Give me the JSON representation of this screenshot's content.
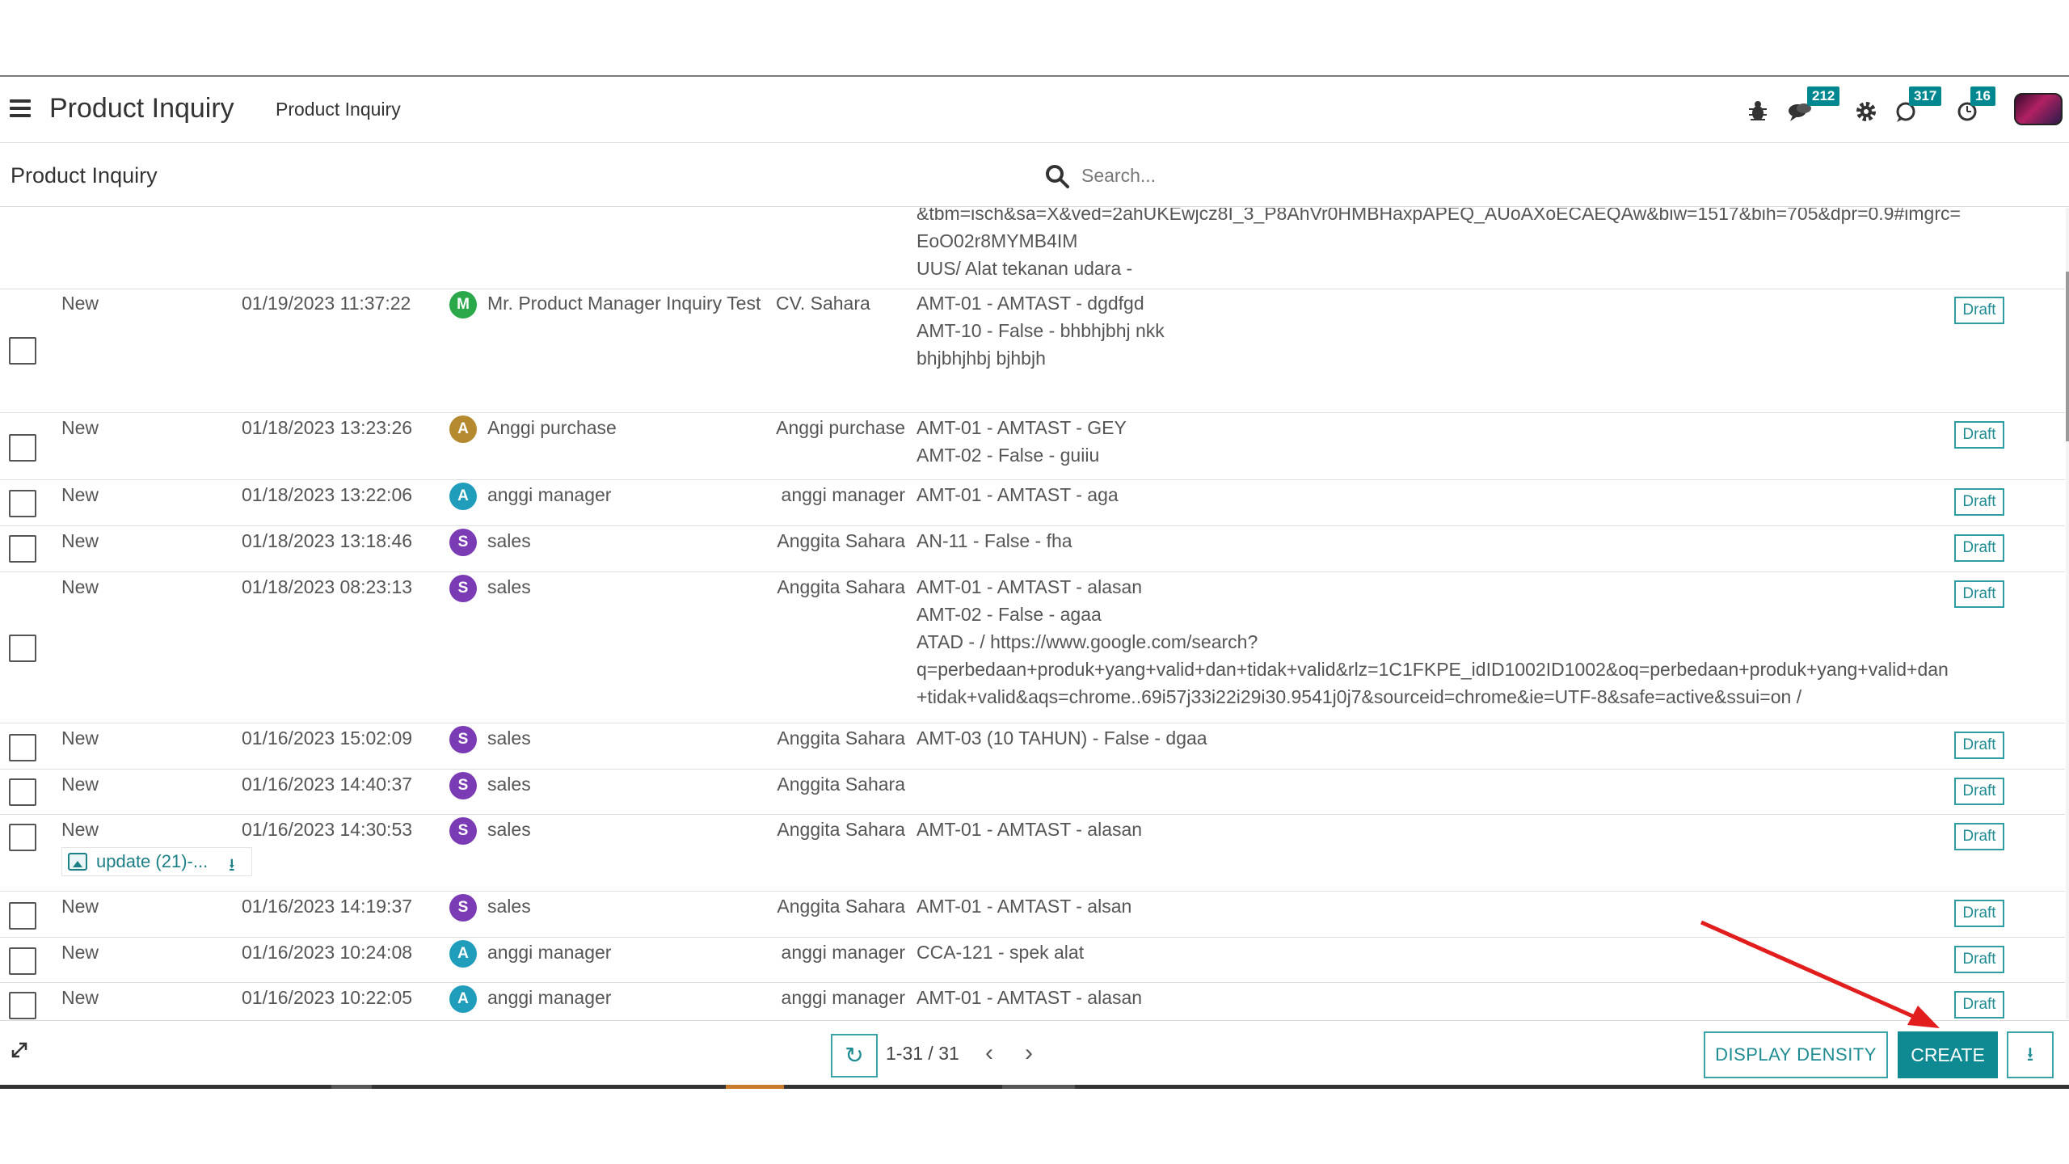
{
  "header": {
    "app_title": "Product Inquiry",
    "breadcrumb": "Product Inquiry",
    "chat_count": "212",
    "activity_count": "317",
    "clock_count": "16"
  },
  "control_panel": {
    "title": "Product Inquiry",
    "search_placeholder": "Search..."
  },
  "partial_row": {
    "lines": [
      "&tbm=isch&sa=X&ved=2ahUKEwjcz8I_3_P8AhVr0HMBHaxpAPEQ_AUoAXoECAEQAw&biw=1517&bih=705&dpr=0.9#imgrc=",
      "EoO02r8MYMB4IM",
      "UUS/ Alat tekanan udara -"
    ]
  },
  "rows": [
    {
      "status": "New",
      "date": "01/19/2023 11:37:22",
      "avatar_letter": "M",
      "avatar_color": "#2aa84a",
      "user": "Mr. Product Manager Inquiry Test",
      "company": "CV. Sahara",
      "details": [
        "AMT-01 - AMTAST - dgdfgd",
        "AMT-10 - False - bhbhjbhj nkk",
        "bhjbhjhbj bjhbjh"
      ],
      "state": "Draft"
    },
    {
      "status": "New",
      "date": "01/18/2023 13:23:26",
      "avatar_letter": "A",
      "avatar_color": "#b58a2e",
      "user": "Anggi purchase",
      "company": "Anggi purchase",
      "details": [
        "AMT-01 - AMTAST - GEY",
        "AMT-02 - False - guiiu"
      ],
      "state": "Draft"
    },
    {
      "status": "New",
      "date": "01/18/2023 13:22:06",
      "avatar_letter": "A",
      "avatar_color": "#1f9dbb",
      "user": "anggi manager",
      "company": "anggi manager",
      "details": [
        "AMT-01 - AMTAST - aga"
      ],
      "state": "Draft"
    },
    {
      "status": "New",
      "date": "01/18/2023 13:18:46",
      "avatar_letter": "S",
      "avatar_color": "#7a3bb5",
      "user": "sales",
      "company": "Anggita Sahara",
      "details": [
        "AN-11 - False - fha"
      ],
      "state": "Draft"
    },
    {
      "status": "New",
      "date": "01/18/2023 08:23:13",
      "avatar_letter": "S",
      "avatar_color": "#7a3bb5",
      "user": "sales",
      "company": "Anggita Sahara",
      "details": [
        "AMT-01 - AMTAST - alasan",
        "AMT-02 - False - agaa",
        "ATAD - / https://www.google.com/search?",
        "q=perbedaan+produk+yang+valid+dan+tidak+valid&rlz=1C1FKPE_idID1002ID1002&oq=perbedaan+produk+yang+valid+dan",
        "+tidak+valid&aqs=chrome..69i57j33i22i29i30.9541j0j7&sourceid=chrome&ie=UTF-8&safe=active&ssui=on /"
      ],
      "state": "Draft"
    },
    {
      "status": "New",
      "date": "01/16/2023 15:02:09",
      "avatar_letter": "S",
      "avatar_color": "#7a3bb5",
      "user": "sales",
      "company": "Anggita Sahara",
      "details": [
        "AMT-03 (10 TAHUN) - False - dgaa"
      ],
      "state": "Draft"
    },
    {
      "status": "New",
      "date": "01/16/2023 14:40:37",
      "avatar_letter": "S",
      "avatar_color": "#7a3bb5",
      "user": "sales",
      "company": "Anggita Sahara",
      "details": [],
      "state": "Draft"
    },
    {
      "status": "New",
      "date": "01/16/2023 14:30:53",
      "avatar_letter": "S",
      "avatar_color": "#7a3bb5",
      "user": "sales",
      "company": "Anggita Sahara",
      "details": [
        "AMT-01 - AMTAST - alasan"
      ],
      "attachment": "update (21)-...",
      "state": "Draft"
    },
    {
      "status": "New",
      "date": "01/16/2023 14:19:37",
      "avatar_letter": "S",
      "avatar_color": "#7a3bb5",
      "user": "sales",
      "company": "Anggita Sahara",
      "details": [
        "AMT-01 - AMTAST - alsan"
      ],
      "state": "Draft"
    },
    {
      "status": "New",
      "date": "01/16/2023 10:24:08",
      "avatar_letter": "A",
      "avatar_color": "#1f9dbb",
      "user": "anggi manager",
      "company": "anggi manager",
      "details": [
        "CCA-121 - spek alat"
      ],
      "state": "Draft"
    },
    {
      "status": "New",
      "date": "01/16/2023 10:22:05",
      "avatar_letter": "A",
      "avatar_color": "#1f9dbb",
      "user": "anggi manager",
      "company": "anggi manager",
      "details": [
        "AMT-01 - AMTAST - alasan"
      ],
      "state": "Draft"
    }
  ],
  "footer": {
    "pager_value": "1-31 / 31",
    "display_density_label": "DISPLAY DENSITY",
    "create_label": "CREATE"
  },
  "colors": {
    "accent": "#00878f",
    "annotation_arrow": "#e11d1d"
  }
}
